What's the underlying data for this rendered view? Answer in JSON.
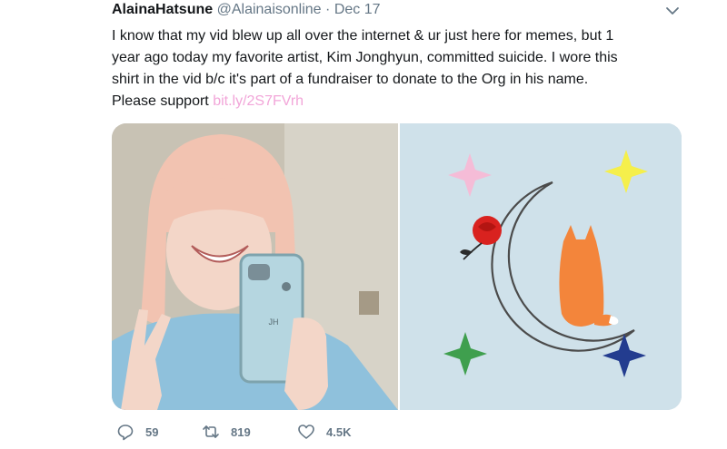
{
  "tweet": {
    "author_name": "AlainaHatsune",
    "handle": "@Alainaisonline",
    "separator": "·",
    "date": "Dec 17",
    "text_lines": [
      "I know that my vid blew up all over the internet & ur just here for memes, but 1",
      "year ago today my favorite artist, Kim Jonghyun, committed suicide. I wore this",
      "shirt in the vid b/c it's part of a fundraiser to donate to the Org in his name.",
      "Please support "
    ],
    "link_text": "bit.ly/2S7FVrh",
    "link_color": "#f2a6d9"
  },
  "actions": {
    "reply_count": "59",
    "retweet_count": "819",
    "like_count": "4.5K"
  },
  "icons": [
    "chevron-down-icon",
    "reply-icon",
    "retweet-icon",
    "like-icon"
  ],
  "colors": {
    "text": "#14171a",
    "muted": "#657786",
    "art_background": "#cfe1ea",
    "fox": "#f3853b",
    "rose": "#d9221f"
  }
}
